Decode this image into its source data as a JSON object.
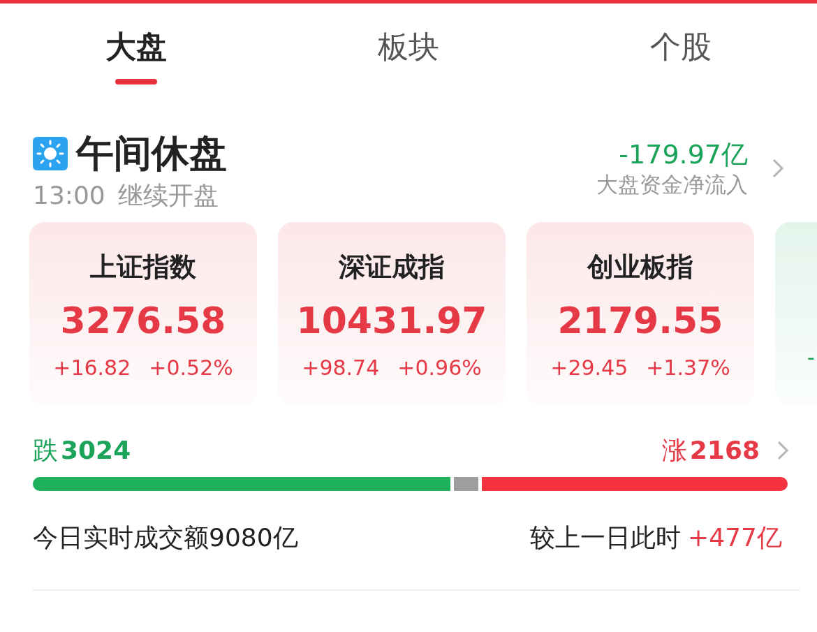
{
  "tabs": [
    {
      "label": "大盘",
      "selected": true
    },
    {
      "label": "板块",
      "selected": false
    },
    {
      "label": "个股",
      "selected": false
    }
  ],
  "status": {
    "title": "午间休盘",
    "time": "13:00",
    "subtitle": "继续开盘",
    "net_flow": "-179.97亿",
    "net_flow_label": "大盘资金净流入"
  },
  "indices": [
    {
      "name": "上证指数",
      "value": "3276.58",
      "change": "+16.82",
      "percent": "+0.52%",
      "color": "#e63946"
    },
    {
      "name": "深证成指",
      "value": "10431.97",
      "change": "+98.74",
      "percent": "+0.96%",
      "color": "#e63946"
    },
    {
      "name": "创业板指",
      "value": "2179.55",
      "change": "+29.45",
      "percent": "+1.37%",
      "color": "#e63946"
    },
    {
      "change": "-",
      "color": "#1ba35a"
    }
  ],
  "breadth": {
    "fall_label": "跌",
    "fall_count": "3024",
    "rise_label": "涨",
    "rise_count": "2168"
  },
  "turnover": {
    "label": "今日实时成交额",
    "amount": "9080亿",
    "compare_label": "较上一日此时",
    "compare_value": "+477亿"
  }
}
